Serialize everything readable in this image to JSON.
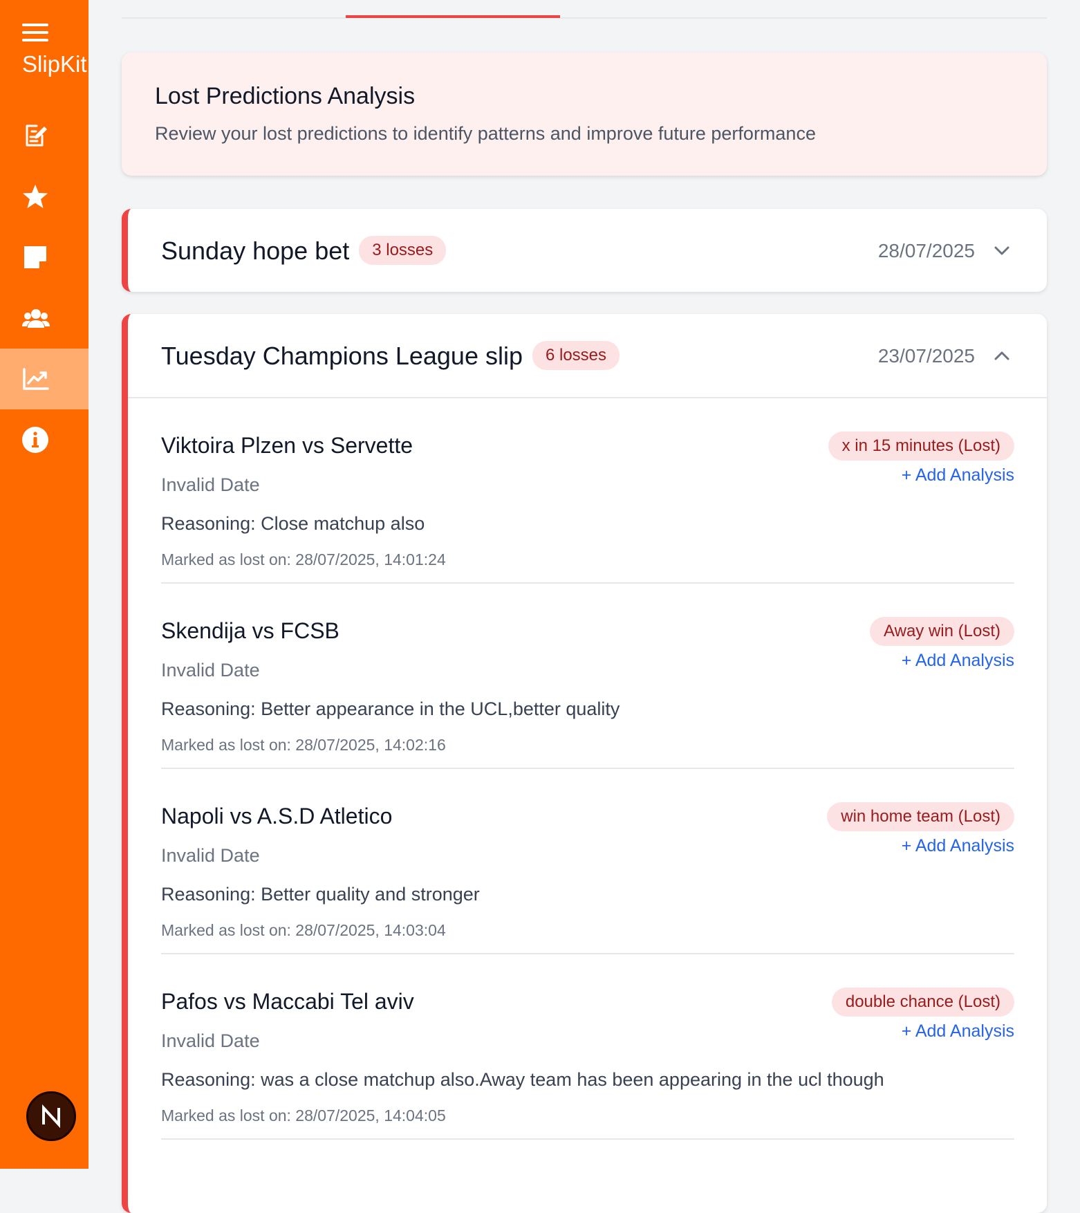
{
  "app": {
    "brand": "SlipKit"
  },
  "sidebar": {
    "items": [
      {
        "icon": "edit-icon"
      },
      {
        "icon": "star-icon"
      },
      {
        "icon": "note-icon"
      },
      {
        "icon": "users-icon"
      },
      {
        "icon": "chart-icon",
        "active": true
      },
      {
        "icon": "info-icon"
      }
    ],
    "avatar_letter": "N"
  },
  "header": {
    "title": "Lost Predictions Analysis",
    "subtitle": "Review your lost predictions to identify patterns and improve future performance"
  },
  "slips": [
    {
      "name": "Sunday hope bet",
      "badge": "3 losses",
      "date": "28/07/2025",
      "expanded": false
    },
    {
      "name": "Tuesday Champions League slip",
      "badge": "6 losses",
      "date": "23/07/2025",
      "expanded": true,
      "predictions": [
        {
          "match": "Viktoira Plzen vs Servette",
          "pick": "x in 15 minutes (Lost)",
          "date": "Invalid Date",
          "reasoning": "Reasoning: Close matchup also",
          "marked": "Marked as lost on: 28/07/2025, 14:01:24",
          "action": "+ Add Analysis"
        },
        {
          "match": "Skendija vs FCSB",
          "pick": "Away win (Lost)",
          "date": "Invalid Date",
          "reasoning": "Reasoning: Better appearance in the UCL,better quality",
          "marked": "Marked as lost on: 28/07/2025, 14:02:16",
          "action": "+ Add Analysis"
        },
        {
          "match": "Napoli vs A.S.D Atletico",
          "pick": "win home team (Lost)",
          "date": "Invalid Date",
          "reasoning": "Reasoning: Better quality and stronger",
          "marked": "Marked as lost on: 28/07/2025, 14:03:04",
          "action": "+ Add Analysis"
        },
        {
          "match": "Pafos vs Maccabi Tel aviv",
          "pick": "double chance (Lost)",
          "date": "Invalid Date",
          "reasoning": "Reasoning: was a close matchup also.Away team has been appearing in the ucl though",
          "marked": "Marked as lost on: 28/07/2025, 14:04:05",
          "action": "+ Add Analysis"
        }
      ]
    }
  ],
  "colors": {
    "sidebar": "#ff6a00",
    "sidebar_active": "#ffac6e",
    "accent_red": "#ef4444",
    "badge_bg": "#fde2e4",
    "badge_text": "#991b1b",
    "link": "#2563eb"
  }
}
